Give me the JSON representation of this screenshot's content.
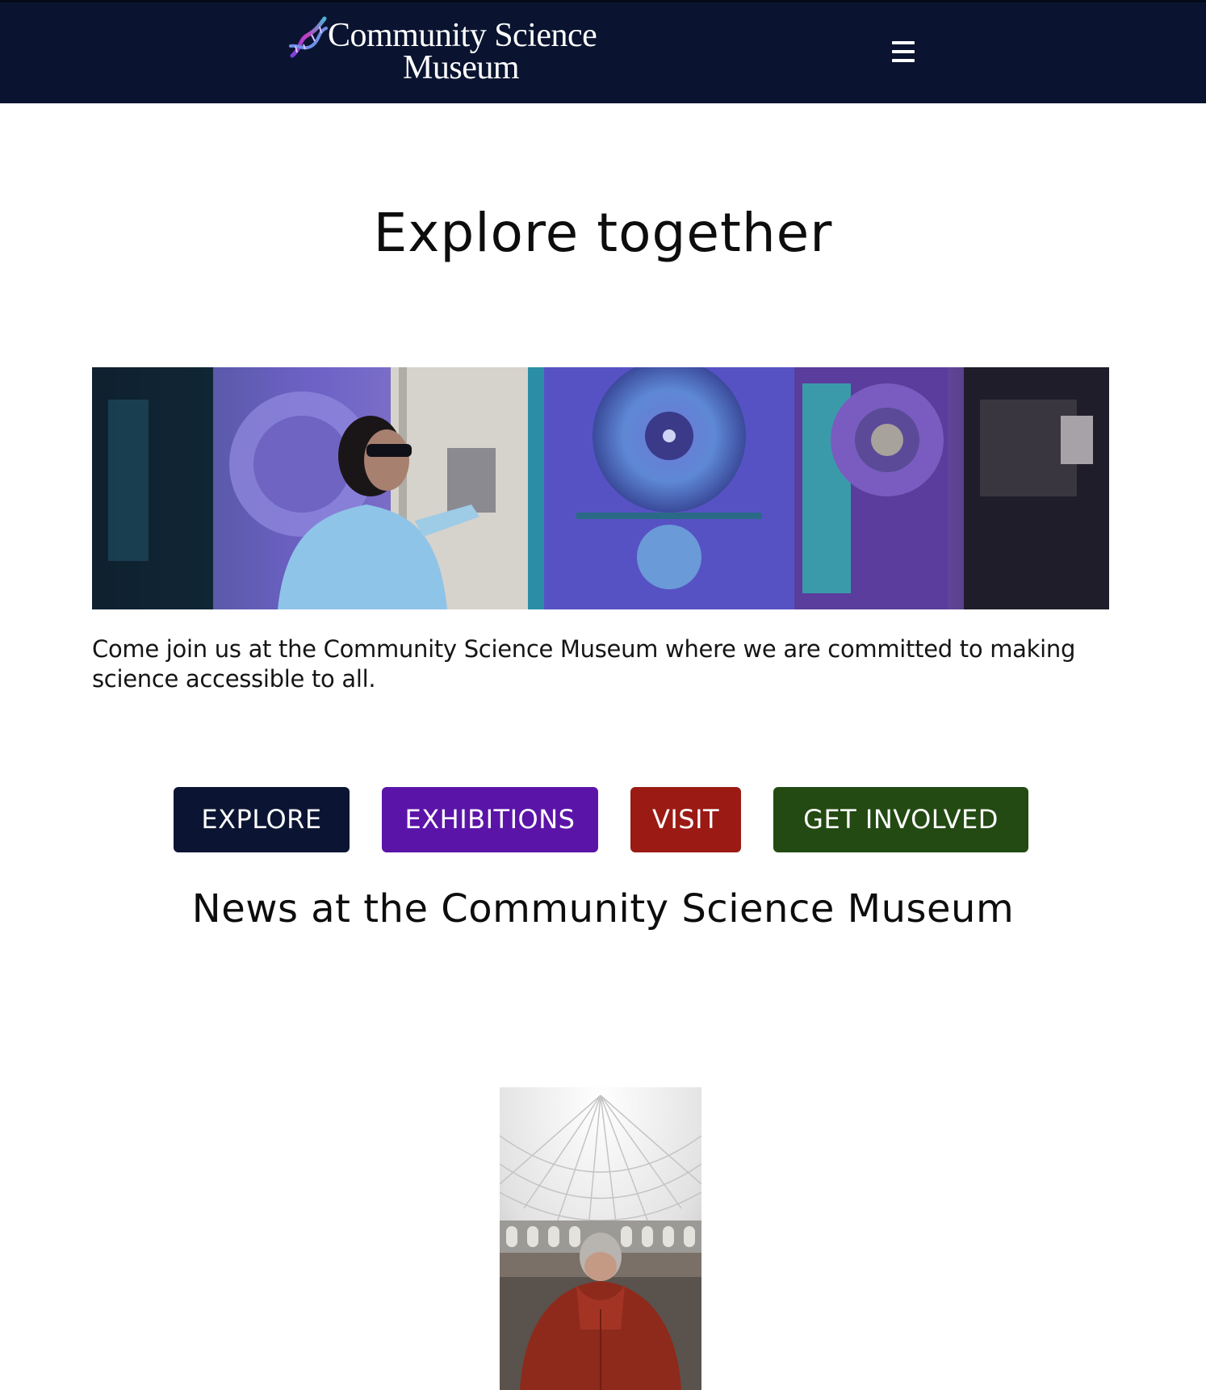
{
  "header": {
    "logo_line1": "Community Science",
    "logo_line2": "Museum",
    "menu_label": "Menu",
    "background": "#0a1430"
  },
  "hero": {
    "title": "Explore together",
    "image_alt": "Scientist in lab coat and goggles beside large purple laboratory machinery"
  },
  "intro": {
    "text": "Come join us at the Community Science Museum where we are committed to making science accessible to all."
  },
  "cta_buttons": [
    {
      "label": "EXPLORE",
      "color": "#0b1533"
    },
    {
      "label": "EXHIBITIONS",
      "color": "#5b14a8"
    },
    {
      "label": "VISIT",
      "color": "#9b1a14"
    },
    {
      "label": "GET INVOLVED",
      "color": "#234a12"
    }
  ],
  "news": {
    "title": "News at the Community Science Museum",
    "image_alt": "Person in red jacket looking over a domed atrium"
  }
}
